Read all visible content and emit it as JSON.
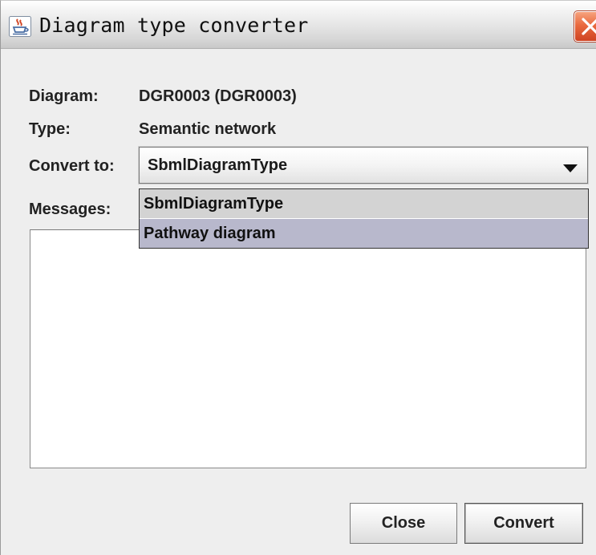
{
  "window": {
    "title": "Diagram type converter",
    "icon": "java-cup-icon",
    "close_icon": "close-x-icon"
  },
  "form": {
    "diagram_label": "Diagram:",
    "diagram_value": "DGR0003 (DGR0003)",
    "type_label": "Type:",
    "type_value": "Semantic network",
    "convert_label": "Convert to:",
    "convert_selected": "SbmlDiagramType",
    "messages_label": "Messages:"
  },
  "dropdown": {
    "options": [
      {
        "label": "SbmlDiagramType"
      },
      {
        "label": "Pathway diagram"
      }
    ]
  },
  "messages": {
    "content": ""
  },
  "buttons": {
    "close": "Close",
    "convert": "Convert"
  },
  "colors": {
    "window_bg": "#eeeeee",
    "close_button": "#e45a32",
    "option_selected": "#d3d3d3",
    "option_hover": "#b8b8cc"
  }
}
